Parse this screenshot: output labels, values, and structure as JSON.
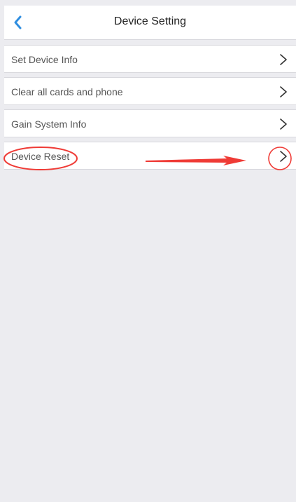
{
  "header": {
    "title": "Device Setting",
    "back_icon": "chevron-left-icon"
  },
  "menu": {
    "items": [
      {
        "label": "Set Device Info",
        "icon": "chevron-right-icon"
      },
      {
        "label": "Clear all cards and phone",
        "icon": "chevron-right-icon"
      },
      {
        "label": "Gain System Info",
        "icon": "chevron-right-icon"
      },
      {
        "label": "Device Reset",
        "icon": "chevron-right-icon"
      }
    ]
  },
  "colors": {
    "background": "#ececf0",
    "row_background": "#ffffff",
    "accent_blue": "#2f8ee0",
    "annotation_red": "#ef3b36"
  }
}
